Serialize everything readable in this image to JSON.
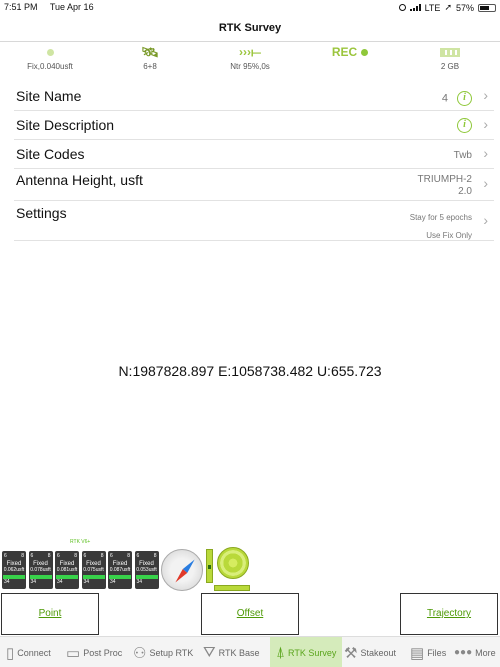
{
  "status": {
    "time": "7:51 PM",
    "date": "Tue Apr 16",
    "network": "LTE",
    "battery": "57%",
    "battery_level": 0.57
  },
  "nav": {
    "title": "RTK Survey"
  },
  "info_bar": {
    "fix": "Fix,0.040usft",
    "satellites": "6+8",
    "link": "Ntr 95%,0s",
    "rec": "REC",
    "storage": "2 GB"
  },
  "rows": {
    "site_name": {
      "label": "Site Name",
      "value": "4"
    },
    "site_description": {
      "label": "Site Description"
    },
    "site_codes": {
      "label": "Site Codes",
      "value": "Twb"
    },
    "antenna_height": {
      "label": "Antenna Height, usft",
      "value1": "TRIUMPH-2",
      "value2": "2.0"
    },
    "settings": {
      "label": "Settings",
      "value1": "Stay for 5 epochs",
      "value2": "Use Fix Only"
    }
  },
  "coordinates": "N:1987828.897 E:1058738.482 U:655.723",
  "receivers": {
    "label": "RTK V6+",
    "items": [
      {
        "a": "6",
        "b": "8",
        "status": "Fixed",
        "acc": "0.062usft",
        "count": "34"
      },
      {
        "a": "6",
        "b": "8",
        "status": "Fixed",
        "acc": "0.078usft",
        "count": "34"
      },
      {
        "a": "6",
        "b": "8",
        "status": "Fixed",
        "acc": "0.081usft",
        "count": "34"
      },
      {
        "a": "6",
        "b": "8",
        "status": "Fixed",
        "acc": "0.075usft",
        "count": "34"
      },
      {
        "a": "6",
        "b": "8",
        "status": "Fixed",
        "acc": "0.087usft",
        "count": "34"
      },
      {
        "a": "6",
        "b": "8",
        "status": "Fixed",
        "acc": "0.053usft",
        "count": "34"
      }
    ]
  },
  "actions": {
    "point": "Point",
    "offset": "Offset",
    "trajectory": "Trajectory"
  },
  "tabs": {
    "connect": "Connect",
    "post_proc": "Post Proc",
    "setup_rtk": "Setup RTK",
    "rtk_base": "RTK Base",
    "rtk_survey": "RTK Survey",
    "stakeout": "Stakeout",
    "files": "Files",
    "more": "More"
  },
  "colors": {
    "accent": "#8fc83a",
    "active_tab_bg": "#d5ebbb",
    "fix_bar": "#38d24a"
  }
}
